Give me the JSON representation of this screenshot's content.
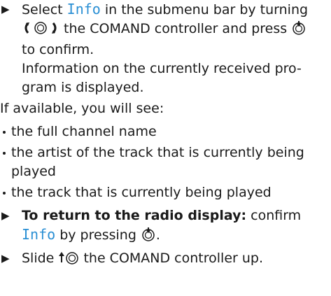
{
  "steps": [
    {
      "segments": [
        "Select ",
        " in the submenu bar by turning ",
        " the COMAND controller and press ",
        "to confirm."
      ],
      "menu_term": "Info",
      "result": "Information on the currently received pro-gram is displayed."
    }
  ],
  "intro": "If available, you will see:",
  "bullets": [
    "the full channel name",
    "the artist of the track that is currently being played",
    "the track that is currently being played"
  ],
  "return_step": {
    "bold_label": "To return to the radio display:",
    "text_before": " confirm",
    "menu_term": "Info",
    "text_after": " by pressing ",
    "text_end": "."
  },
  "slide_step": {
    "word_before": "Slide ",
    "text_after": " the COMAND controller up."
  },
  "icons": {
    "step_marker": "triangle-right-icon",
    "turn_controller": "controller-turn-icon",
    "press_controller": "controller-press-icon",
    "slide_up_controller": "controller-slide-up-icon"
  },
  "colors": {
    "menu_term": "#2a8fd4",
    "text": "#1a1a1a"
  }
}
